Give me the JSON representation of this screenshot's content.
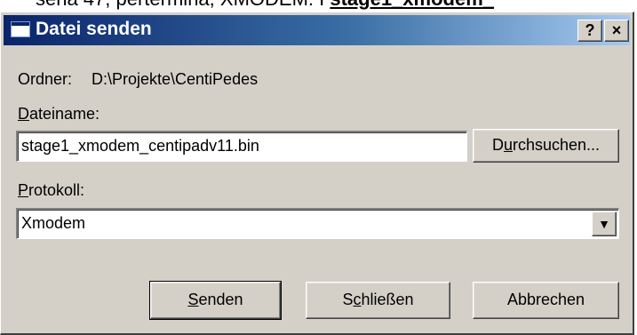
{
  "background": {
    "text_prefix": "sena 47, pertermina, XMODEM: I ",
    "text_bold": "stage1_xmodem_"
  },
  "dialog": {
    "title": "Datei senden",
    "help_glyph": "?",
    "close_glyph": "×",
    "folder_label": "Ordner:",
    "folder_value": "D:\\Projekte\\CentiPedes",
    "filename_label": "Dateiname:",
    "filename_value": "stage1_xmodem_centipadv11.bin",
    "browse_label": "Durchsuchen...",
    "protocol_label": "Protokoll:",
    "protocol_value": "Xmodem",
    "dropdown_glyph": "▼",
    "send_label": "Senden",
    "close_label": "Schließen",
    "cancel_label": "Abbrechen"
  }
}
